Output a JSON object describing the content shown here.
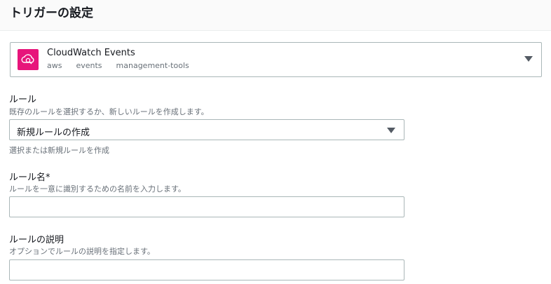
{
  "header": {
    "title": "トリガーの設定"
  },
  "trigger": {
    "name": "CloudWatch Events",
    "tags": [
      "aws",
      "events",
      "management-tools"
    ],
    "icon": "cloudwatch-events-icon",
    "icon_color": "#e7157b"
  },
  "rule": {
    "label": "ルール",
    "description": "既存のルールを選択するか、新しいルールを作成します。",
    "selected": "新規ルールの作成",
    "hint": "選択または新規ルールを作成"
  },
  "rule_name": {
    "label": "ルール名*",
    "description": "ルールを一意に識別するための名前を入力します。",
    "value": ""
  },
  "rule_description": {
    "label": "ルールの説明",
    "description": "オプションでルールの説明を指定します。",
    "value": ""
  }
}
